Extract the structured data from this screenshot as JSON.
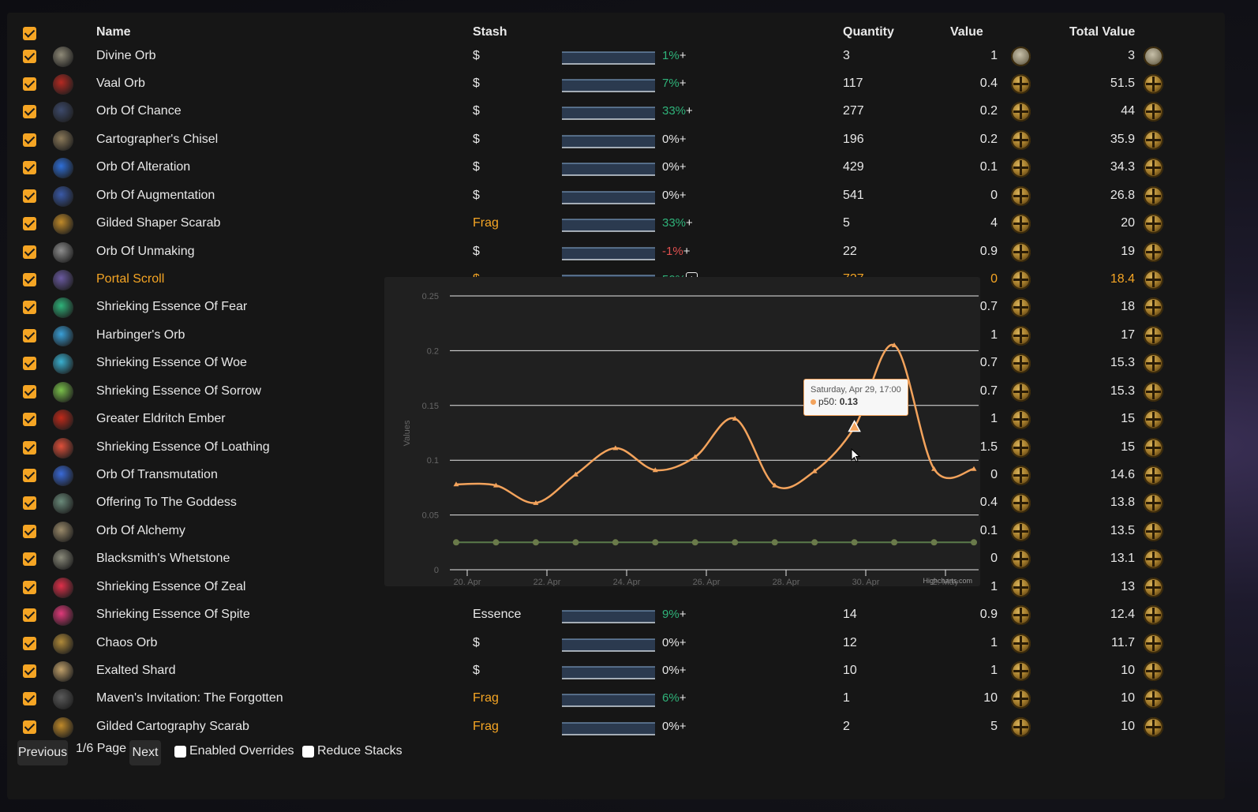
{
  "header": {
    "name": "Name",
    "stash": "Stash",
    "quantity": "Quantity",
    "value": "Value",
    "total_value": "Total Value"
  },
  "plus": "+",
  "rows": [
    {
      "name": "Divine Orb",
      "stash": "$",
      "pct": "1%",
      "pct_class": "green",
      "qty": "3",
      "value": "1",
      "total": "3",
      "currency": "divine",
      "color": "#8f8a78"
    },
    {
      "name": "Vaal Orb",
      "stash": "$",
      "pct": "7%",
      "pct_class": "green",
      "qty": "117",
      "value": "0.4",
      "total": "51.5",
      "currency": "chaos",
      "color": "#b52a22"
    },
    {
      "name": "Orb Of Chance",
      "stash": "$",
      "pct": "33%",
      "pct_class": "green",
      "qty": "277",
      "value": "0.2",
      "total": "44",
      "currency": "chaos",
      "color": "#3d4a6b"
    },
    {
      "name": "Cartographer's Chisel",
      "stash": "$",
      "pct": "0%",
      "pct_class": "",
      "qty": "196",
      "value": "0.2",
      "total": "35.9",
      "currency": "chaos",
      "color": "#8c7a5a"
    },
    {
      "name": "Orb Of Alteration",
      "stash": "$",
      "pct": "0%",
      "pct_class": "",
      "qty": "429",
      "value": "0.1",
      "total": "34.3",
      "currency": "chaos",
      "color": "#2f6fd8"
    },
    {
      "name": "Orb Of Augmentation",
      "stash": "$",
      "pct": "0%",
      "pct_class": "",
      "qty": "541",
      "value": "0",
      "total": "26.8",
      "currency": "chaos",
      "color": "#3a5aa8"
    },
    {
      "name": "Gilded Shaper Scarab",
      "stash": "Frag",
      "pct": "33%",
      "pct_class": "green",
      "qty": "5",
      "value": "4",
      "total": "20",
      "currency": "chaos",
      "color": "#c08a2a"
    },
    {
      "name": "Orb Of Unmaking",
      "stash": "$",
      "pct": "-1%",
      "pct_class": "red",
      "qty": "22",
      "value": "0.9",
      "total": "19",
      "currency": "chaos",
      "color": "#8d8d8d"
    },
    {
      "name": "Portal Scroll",
      "stash": "$",
      "pct": "50%",
      "pct_class": "green",
      "qty": "737",
      "value": "0",
      "total": "18.4",
      "currency": "chaos",
      "color": "#6a5aa0",
      "highlight": true
    },
    {
      "name": "Shrieking Essence Of Fear",
      "stash": "",
      "pct": "",
      "pct_class": "",
      "qty": "",
      "value": "0.7",
      "total": "18",
      "currency": "chaos",
      "color": "#2fb37a"
    },
    {
      "name": "Harbinger's Orb",
      "stash": "",
      "pct": "",
      "pct_class": "",
      "qty": "",
      "value": "1",
      "total": "17",
      "currency": "chaos",
      "color": "#3aa0d8"
    },
    {
      "name": "Shrieking Essence Of Woe",
      "stash": "",
      "pct": "",
      "pct_class": "",
      "qty": "",
      "value": "0.7",
      "total": "15.3",
      "currency": "chaos",
      "color": "#3ab0d0"
    },
    {
      "name": "Shrieking Essence Of Sorrow",
      "stash": "",
      "pct": "",
      "pct_class": "",
      "qty": "",
      "value": "0.7",
      "total": "15.3",
      "currency": "chaos",
      "color": "#7ac04a"
    },
    {
      "name": "Greater Eldritch Ember",
      "stash": "",
      "pct": "",
      "pct_class": "",
      "qty": "",
      "value": "1",
      "total": "15",
      "currency": "chaos",
      "color": "#c02a1a"
    },
    {
      "name": "Shrieking Essence Of Loathing",
      "stash": "",
      "pct": "",
      "pct_class": "",
      "qty": "",
      "value": "1.5",
      "total": "15",
      "currency": "chaos",
      "color": "#e0503a"
    },
    {
      "name": "Orb Of Transmutation",
      "stash": "",
      "pct": "",
      "pct_class": "",
      "qty": "",
      "value": "0",
      "total": "14.6",
      "currency": "chaos",
      "color": "#3a6ad8"
    },
    {
      "name": "Offering To The Goddess",
      "stash": "",
      "pct": "",
      "pct_class": "",
      "qty": "",
      "value": "0.4",
      "total": "13.8",
      "currency": "chaos",
      "color": "#6a8a7a"
    },
    {
      "name": "Orb Of Alchemy",
      "stash": "",
      "pct": "",
      "pct_class": "",
      "qty": "",
      "value": "0.1",
      "total": "13.5",
      "currency": "chaos",
      "color": "#9a8a6a"
    },
    {
      "name": "Blacksmith's Whetstone",
      "stash": "",
      "pct": "",
      "pct_class": "",
      "qty": "",
      "value": "0",
      "total": "13.1",
      "currency": "chaos",
      "color": "#8a8a7a"
    },
    {
      "name": "Shrieking Essence Of Zeal",
      "stash": "",
      "pct": "",
      "pct_class": "",
      "qty": "",
      "value": "1",
      "total": "13",
      "currency": "chaos",
      "color": "#e0304a"
    },
    {
      "name": "Shrieking Essence Of Spite",
      "stash": "Essence",
      "pct": "9%",
      "pct_class": "green",
      "qty": "14",
      "value": "0.9",
      "total": "12.4",
      "currency": "chaos",
      "color": "#e03a7a"
    },
    {
      "name": "Chaos Orb",
      "stash": "$",
      "pct": "0%",
      "pct_class": "",
      "qty": "12",
      "value": "1",
      "total": "11.7",
      "currency": "chaos",
      "color": "#b08a3a"
    },
    {
      "name": "Exalted Shard",
      "stash": "$",
      "pct": "0%",
      "pct_class": "",
      "qty": "10",
      "value": "1",
      "total": "10",
      "currency": "chaos",
      "color": "#c0a06a"
    },
    {
      "name": "Maven's Invitation: The Forgotten",
      "stash": "Frag",
      "pct": "6%",
      "pct_class": "green",
      "qty": "1",
      "value": "10",
      "total": "10",
      "currency": "chaos",
      "color": "#5a5a5a"
    },
    {
      "name": "Gilded Cartography Scarab",
      "stash": "Frag",
      "pct": "0%",
      "pct_class": "",
      "qty": "2",
      "value": "5",
      "total": "10",
      "currency": "chaos",
      "color": "#c08a2a"
    }
  ],
  "footer": {
    "previous": "Previous",
    "page": "1/6 Page",
    "next": "Next",
    "enabled_overrides": "Enabled Overrides",
    "reduce_stacks": "Reduce Stacks"
  },
  "chart_data": {
    "type": "line",
    "ylabel": "Values",
    "ylim": [
      0,
      0.25
    ],
    "yticks": [
      "0",
      "0.05",
      "0.1",
      "0.15",
      "0.2",
      "0.25"
    ],
    "xticks": [
      "20. Apr",
      "22. Apr",
      "24. Apr",
      "26. Apr",
      "28. Apr",
      "30. Apr",
      "2. May"
    ],
    "credit": "Highcharts.com",
    "series": [
      {
        "name": "p50",
        "color": "#f3a35c",
        "values": [
          0.078,
          0.077,
          0.061,
          0.087,
          0.111,
          0.091,
          0.103,
          0.138,
          0.077,
          0.09,
          0.13,
          0.205,
          0.092,
          0.092
        ]
      },
      {
        "values": [
          0.025,
          0.025,
          0.025,
          0.025,
          0.025,
          0.025,
          0.025,
          0.025,
          0.025,
          0.025,
          0.025,
          0.025,
          0.025,
          0.025
        ]
      }
    ],
    "tooltip": {
      "date": "Saturday, Apr 29, 17:00",
      "series": "p50",
      "value": "0.13"
    }
  }
}
